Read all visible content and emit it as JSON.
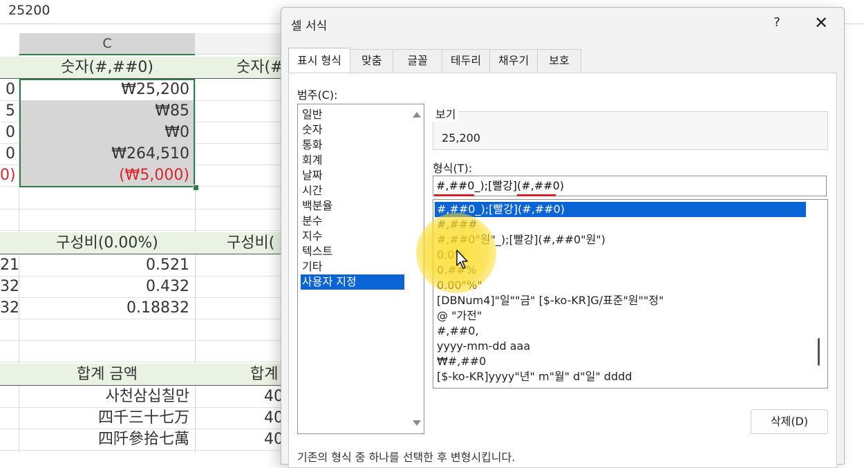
{
  "formula_bar": {
    "value": "25200"
  },
  "sheet": {
    "column_header": "C",
    "section1": {
      "header_c": "숫자(#,##0)",
      "header_d": "숫자(#",
      "rows": [
        {
          "a": "0",
          "c": "₩25,200",
          "red": false
        },
        {
          "a": "5",
          "c": "₩85",
          "red": false
        },
        {
          "a": "0",
          "c": "₩0",
          "red": false
        },
        {
          "a": "0",
          "c": "₩264,510",
          "red": false
        },
        {
          "a": "0)",
          "c": "(₩5,000)",
          "red": true
        }
      ]
    },
    "section2": {
      "header_c": "구성비(0.00%)",
      "header_d": "구성비(",
      "rows": [
        {
          "a": "21",
          "c": "0.521"
        },
        {
          "a": "32",
          "c": "0.432"
        },
        {
          "a": "32",
          "c": "0.18832"
        }
      ]
    },
    "section3": {
      "header_c": "합계 금액",
      "header_d": "합계",
      "rows": [
        {
          "c": "사천삼십칠만",
          "d": "40"
        },
        {
          "c": "四千三十七万",
          "d": "40"
        },
        {
          "c": "四阡參拾七萬",
          "d": "40"
        }
      ]
    }
  },
  "dialog": {
    "title": "셀 서식",
    "help": "?",
    "close": "✕",
    "tabs": [
      "표시 형식",
      "맞춤",
      "글꼴",
      "테두리",
      "채우기",
      "보호"
    ],
    "category_label": "범주(C):",
    "categories": [
      "일반",
      "숫자",
      "통화",
      "회계",
      "날짜",
      "시간",
      "백분율",
      "분수",
      "지수",
      "텍스트",
      "기타",
      "사용자 지정"
    ],
    "selected_category": "사용자 지정",
    "sample_label": "보기",
    "sample_value": "25,200",
    "format_label": "형식(T):",
    "format_value": "#,##0_);[빨강](#,##0)",
    "format_list": [
      "#,##0_);[빨강](#,##0)",
      "#,###",
      "#,##0\"원\"_);[빨강](#,##0\"원\")",
      "0.0%",
      "0.##%",
      "0.00\"%\"",
      "[DBNum4]\"일\"\"금\" [$-ko-KR]G/표준\"원\"\"정\"",
      "@ \"가전\"",
      "#,##0,",
      "yyyy-mm-dd aaa",
      "₩#,##0",
      "[$-ko-KR]yyyy\"년\" m\"월\" d\"일\" dddd"
    ],
    "delete_label": "삭제(D)",
    "hint": "기존의 형식 중 하나를 선택한 후 변형시킵니다."
  },
  "colors": {
    "accent": "#0a64d6",
    "excel_green": "#2f7d4b",
    "negative_red": "#d8262e",
    "cursor_highlight": "#f5d81e"
  }
}
